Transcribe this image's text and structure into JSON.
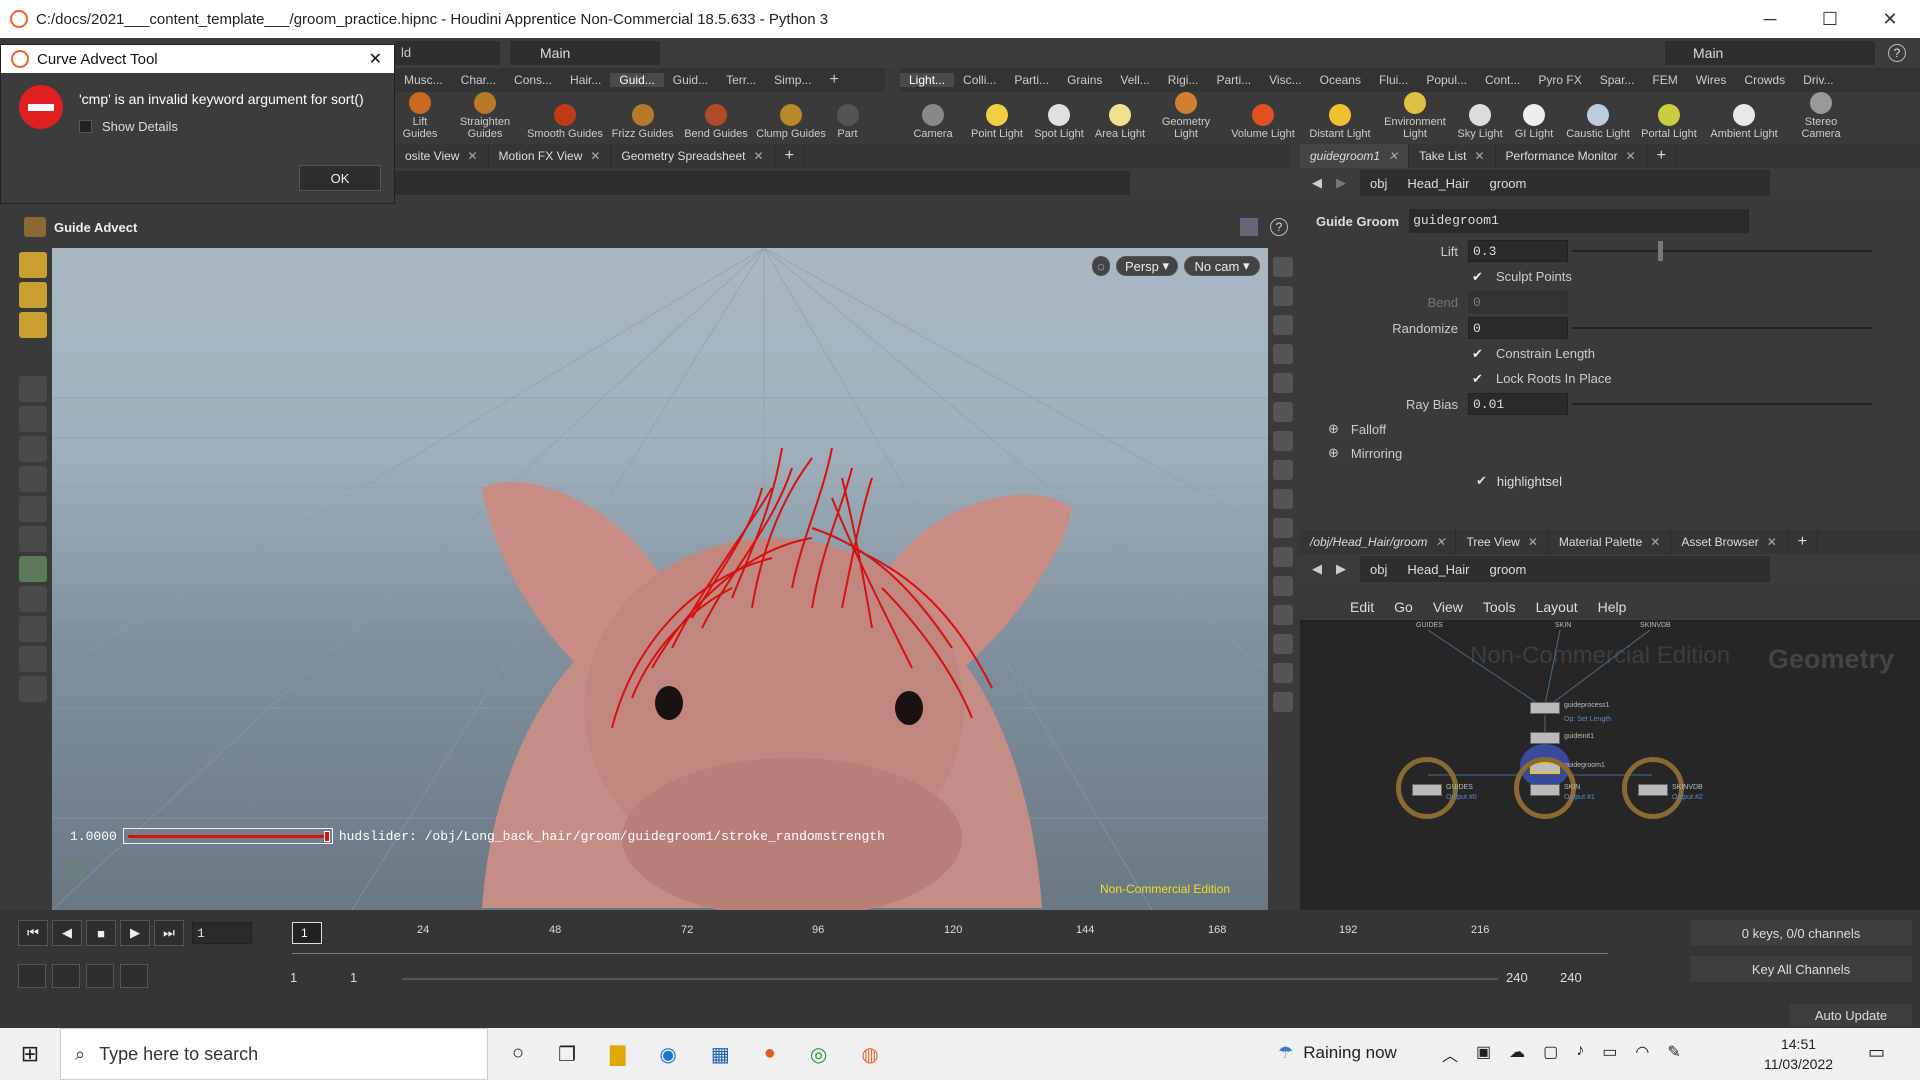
{
  "window": {
    "title": "C:/docs/2021___content_template___/groom_practice.hipnc - Houdini Apprentice Non-Commercial 18.5.633 - Python 3",
    "minimize": "─",
    "maximize": "☐",
    "close": "✕"
  },
  "desktop_selector_left": {
    "partial": "ld",
    "main": "Main"
  },
  "desktop_selector_right": {
    "main": "Main"
  },
  "shelf_tabs_left": [
    "Musc...",
    "Char...",
    "Cons...",
    "Hair...",
    "Guid...",
    "Guid...",
    "Terr...",
    "Simp..."
  ],
  "shelf_tabs_right": [
    "Light...",
    "Colli...",
    "Parti...",
    "Grains",
    "Vell...",
    "Rigi...",
    "Parti...",
    "Visc...",
    "Oceans",
    "Flui...",
    "Popul...",
    "Cont...",
    "Pyro FX",
    "Spar...",
    "FEM",
    "Wires",
    "Crowds",
    "Driv..."
  ],
  "shelf_tools_left": [
    "Lift Guides",
    "Straighten Guides",
    "Smooth Guides",
    "Frizz Guides",
    "Bend Guides",
    "Clump Guides",
    "Part"
  ],
  "shelf_tools_right": [
    "Camera",
    "Point Light",
    "Spot Light",
    "Area Light",
    "Geometry Light",
    "Volume Light",
    "Distant Light",
    "Environment Light",
    "Sky Light",
    "GI Light",
    "Caustic Light",
    "Portal Light",
    "Ambient Light",
    "Stereo Camera"
  ],
  "dialog": {
    "title": "Curve Advect Tool",
    "message": "'cmp' is an invalid keyword argument for sort()",
    "show_details": "Show Details",
    "ok": "OK",
    "close": "✕"
  },
  "viewer_tabs": [
    "osite View",
    "Motion FX View",
    "Geometry Spreadsheet"
  ],
  "viewer": {
    "tool_name": "Guide Advect",
    "persp": "Persp",
    "cam": "No cam",
    "hud_value": "1.0000",
    "hud_text": "hudslider: /obj/Long_back_hair/groom/guidegroom1/stroke_randomstrength",
    "watermark": "Non-Commercial Edition"
  },
  "param_tabs": [
    "guidegroom1",
    "Take List",
    "Performance Monitor"
  ],
  "path": {
    "obj": "obj",
    "head": "Head_Hair",
    "groom": "groom"
  },
  "params": {
    "node_type": "Guide Groom",
    "node_name": "guidegroom1",
    "lift_label": "Lift",
    "lift": "0.3",
    "sculpt": "Sculpt Points",
    "bend_label": "Bend",
    "bend": "0",
    "rand_label": "Randomize",
    "rand": "0",
    "constrain": "Constrain Length",
    "lock": "Lock Roots In Place",
    "ray_label": "Ray Bias",
    "ray": "0.01",
    "falloff": "Falloff",
    "mirroring": "Mirroring",
    "highlight": "highlightsel"
  },
  "network_tabs": [
    "/obj/Head_Hair/groom",
    "Tree View",
    "Material Palette",
    "Asset Browser"
  ],
  "network_menu": [
    "Edit",
    "Go",
    "View",
    "Tools",
    "Layout",
    "Help"
  ],
  "network": {
    "watermark": "Non-Commercial Edition",
    "context": "Geometry",
    "top_labels": [
      "GUIDES",
      "SKIN",
      "SKINVDB"
    ],
    "nodes": [
      "guideprocess1",
      "guideinit1",
      "guidegroom1"
    ],
    "subs": [
      "Op: Set Length"
    ],
    "outputs": [
      "GUIDES",
      "SKIN",
      "SKINVDB"
    ],
    "output_subs": [
      "Output #0",
      "Output #1",
      "Output #2"
    ]
  },
  "timeline": {
    "frame": "1",
    "ticks": [
      "24",
      "48",
      "72",
      "96",
      "120",
      "144",
      "168",
      "192",
      "216"
    ],
    "start_a": "1",
    "start_b": "1",
    "end_a": "240",
    "end_b": "240",
    "keys": "0 keys, 0/0 channels",
    "key_all": "Key All Channels",
    "auto_update": "Auto Update"
  },
  "taskbar": {
    "search": "Type here to search",
    "weather": "Raining now",
    "time": "14:51",
    "date": "11/03/2022"
  }
}
